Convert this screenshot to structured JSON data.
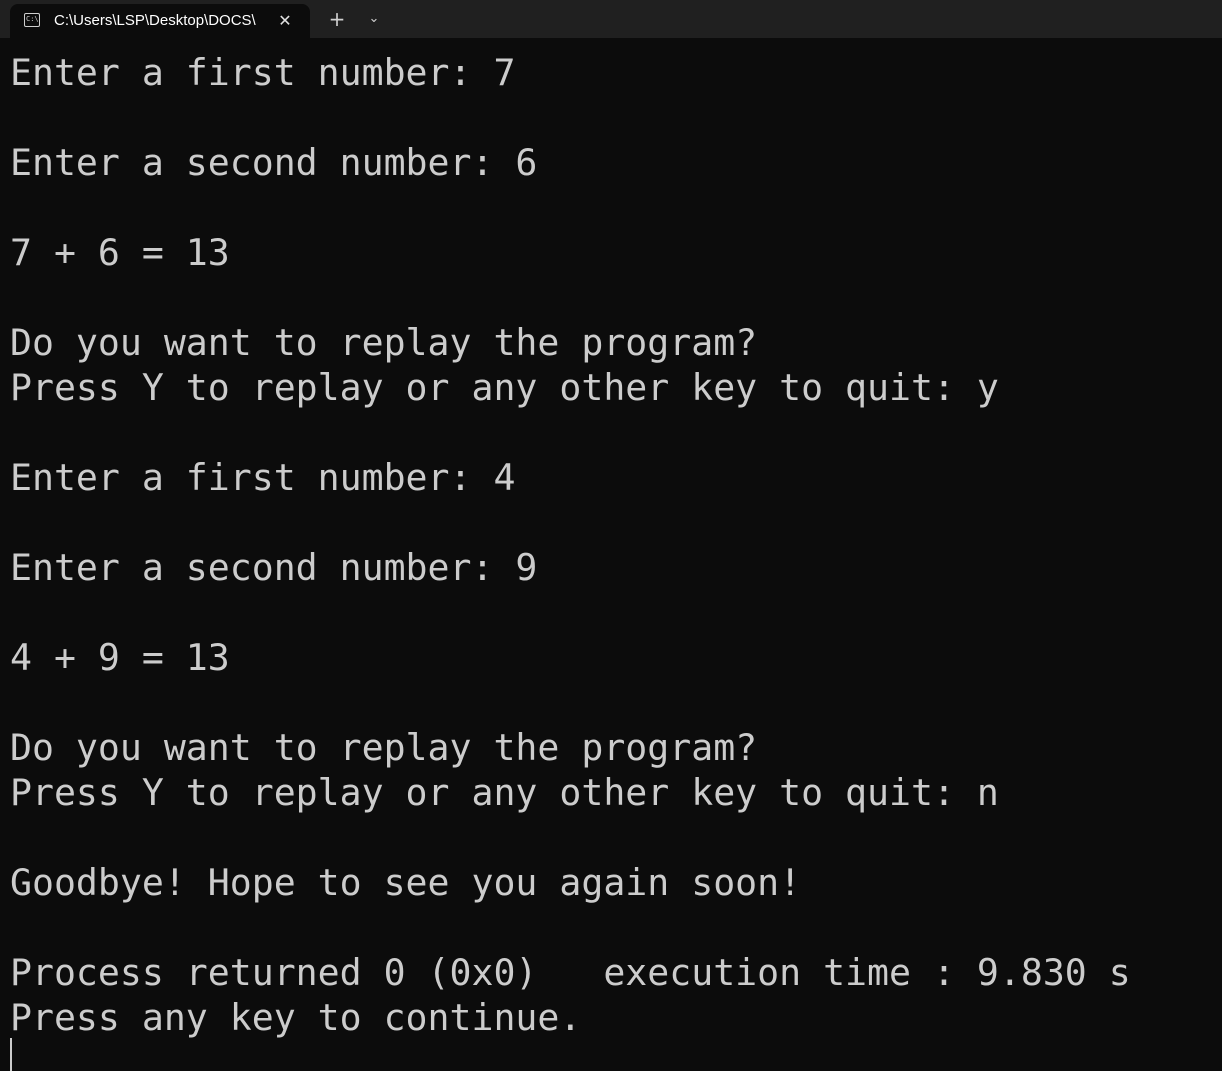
{
  "tab": {
    "title": "C:\\Users\\LSP\\Desktop\\DOCS\\",
    "close_glyph": "✕",
    "new_tab_glyph": "+",
    "dropdown_glyph": "⌄",
    "icon": "console-icon"
  },
  "terminal": {
    "lines": [
      "Enter a first number: 7",
      "",
      "Enter a second number: 6",
      "",
      "7 + 6 = 13",
      "",
      "Do you want to replay the program?",
      "Press Y to replay or any other key to quit: y",
      "",
      "Enter a first number: 4",
      "",
      "Enter a second number: 9",
      "",
      "4 + 9 = 13",
      "",
      "Do you want to replay the program?",
      "Press Y to replay or any other key to quit: n",
      "",
      "Goodbye! Hope to see you again soon!",
      "",
      "Process returned 0 (0x0)   execution time : 9.830 s",
      "Press any key to continue."
    ]
  },
  "colors": {
    "background": "#0c0c0c",
    "tabbar": "#202020",
    "text": "#cccccc"
  }
}
